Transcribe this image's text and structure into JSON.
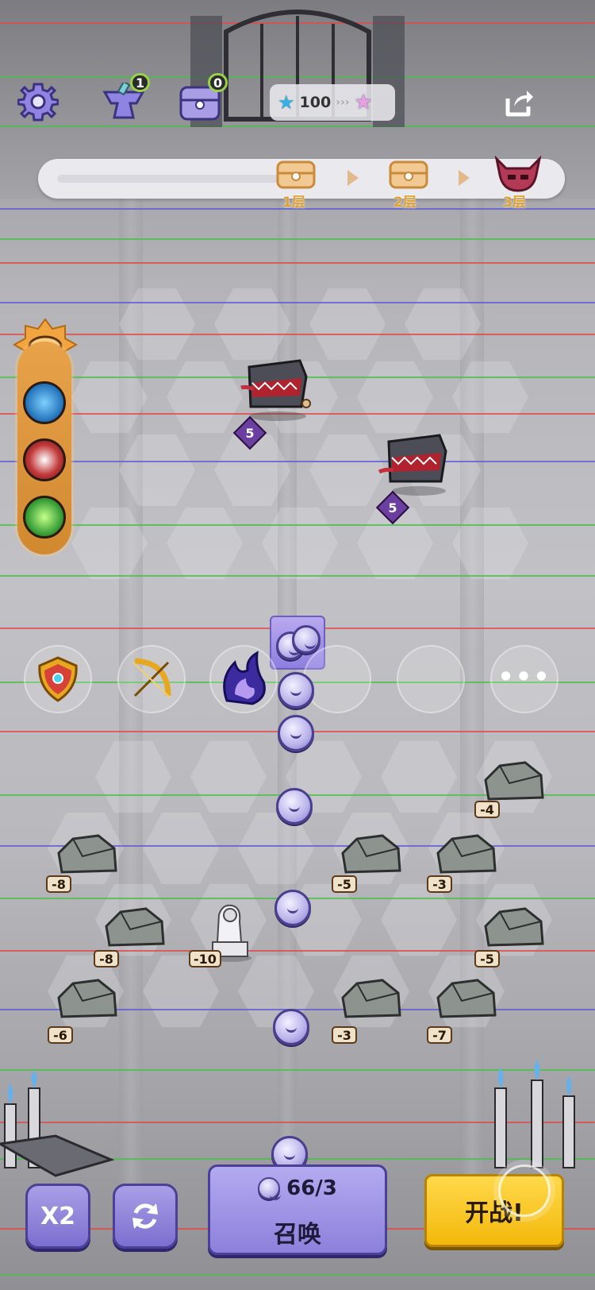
{
  "top_bar": {
    "settings_icon": "gear-icon",
    "anvil_count": "1",
    "chest_count": "0",
    "star_count": "100",
    "share_icon": "share-icon"
  },
  "progress": {
    "floors": [
      {
        "label": "1层",
        "icon": "treasure-chest-icon"
      },
      {
        "label": "2层",
        "icon": "treasure-chest-icon"
      },
      {
        "label": "3层",
        "icon": "boss-demon-icon"
      }
    ]
  },
  "buffs": [
    "dragon-orb-icon",
    "red-burst-orb-icon",
    "green-orb-icon"
  ],
  "enemies": [
    {
      "name": "mimic-chest-monster",
      "level": "5"
    },
    {
      "name": "mimic-chest-monster",
      "level": "5"
    }
  ],
  "skill_slots": [
    "golden-shield-icon",
    "golden-bow-icon",
    "purple-flame-icon",
    "",
    "",
    "more-options-icon"
  ],
  "rocks": [
    {
      "value": "-4"
    },
    {
      "value": "-8"
    },
    {
      "value": "-5"
    },
    {
      "value": "-3"
    },
    {
      "value": "-8"
    },
    {
      "value": "-10"
    },
    {
      "value": "-5"
    },
    {
      "value": "-6"
    },
    {
      "value": "-3"
    },
    {
      "value": "-7"
    }
  ],
  "buttons": {
    "speed_label": "X2",
    "refresh_icon": "refresh-icon",
    "summon_cost": "66/3",
    "summon_label": "召唤",
    "fight_label": "开战!"
  },
  "colors": {
    "accent_gold": "#f3b90c",
    "accent_purple": "#8c80dc",
    "floor_label": "#e0a133"
  }
}
